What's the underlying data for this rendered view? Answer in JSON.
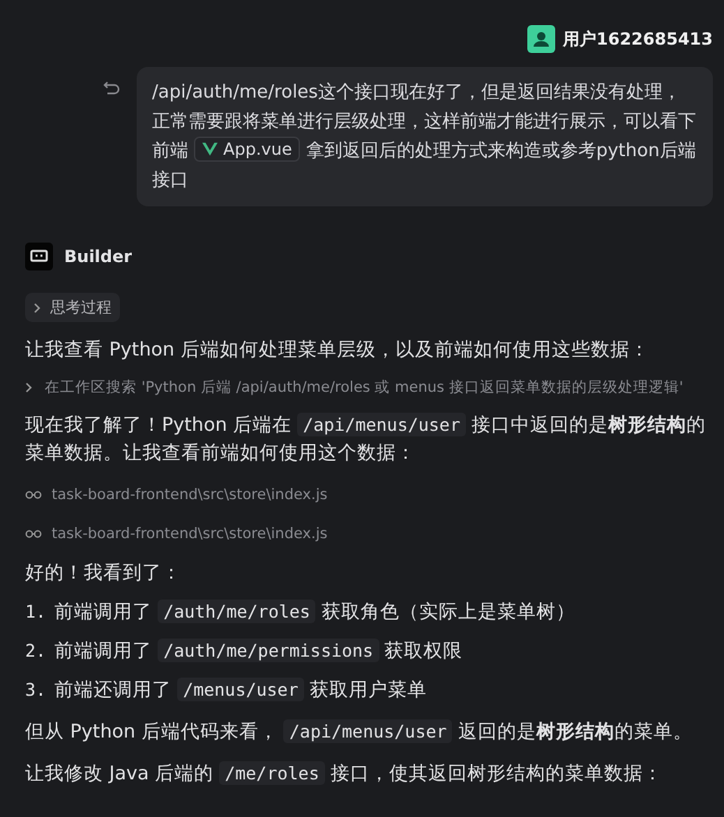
{
  "user": {
    "name": "用户1622685413"
  },
  "user_message": {
    "segments": [
      {
        "kind": "text",
        "text": "/api/auth/me/roles这个接口现在好了，但是返回结果没有处理，正常需要跟将菜单进行层级处理，这样前端才能进行展示，可以看下前端"
      },
      {
        "kind": "file",
        "text": "App.vue"
      },
      {
        "kind": "text",
        "text": "拿到返回后的处理方式来构造或参考python后端接口"
      }
    ]
  },
  "assistant": {
    "name": "Builder",
    "thinking": {
      "label": "思考过程",
      "expanded": false
    },
    "blocks": [
      {
        "kind": "para",
        "segments": [
          {
            "kind": "text",
            "text": "让我查看 Python 后端如何处理菜单层级，以及前端如何使用这些数据："
          }
        ]
      },
      {
        "kind": "search",
        "text": "在工作区搜索 'Python 后端 /api/auth/me/roles 或 menus 接口返回菜单数据的层级处理逻辑'"
      },
      {
        "kind": "para",
        "segments": [
          {
            "kind": "text",
            "text": "现在我了解了！Python 后端在"
          },
          {
            "kind": "code",
            "text": "/api/menus/user"
          },
          {
            "kind": "text",
            "text": "接口中返回的是**树形结构**的菜单数据。让我查看前端如何使用这个数据："
          }
        ]
      },
      {
        "kind": "file",
        "text": "task-board-frontend\\src\\store\\index.js"
      },
      {
        "kind": "file",
        "text": "task-board-frontend\\src\\store\\index.js"
      },
      {
        "kind": "para",
        "segments": [
          {
            "kind": "text",
            "text": "好的！我看到了："
          }
        ]
      },
      {
        "kind": "item",
        "number": "1.",
        "segments": [
          {
            "kind": "text",
            "text": "前端调用了"
          },
          {
            "kind": "code",
            "text": "/auth/me/roles"
          },
          {
            "kind": "text",
            "text": "获取角色（实际上是菜单树）"
          }
        ]
      },
      {
        "kind": "item",
        "number": "2.",
        "segments": [
          {
            "kind": "text",
            "text": "前端调用了"
          },
          {
            "kind": "code",
            "text": "/auth/me/permissions"
          },
          {
            "kind": "text",
            "text": "获取权限"
          }
        ]
      },
      {
        "kind": "item",
        "number": "3.",
        "segments": [
          {
            "kind": "text",
            "text": "前端还调用了"
          },
          {
            "kind": "code",
            "text": "/menus/user"
          },
          {
            "kind": "text",
            "text": "获取用户菜单"
          }
        ]
      },
      {
        "kind": "para",
        "segments": [
          {
            "kind": "text",
            "text": "但从 Python 后端代码来看，"
          },
          {
            "kind": "code",
            "text": "/api/menus/user"
          },
          {
            "kind": "text",
            "text": "返回的是**树形结构**的菜单。"
          }
        ]
      },
      {
        "kind": "para",
        "segments": [
          {
            "kind": "text",
            "text": "让我修改 Java 后端的"
          },
          {
            "kind": "code",
            "text": "/me/roles"
          },
          {
            "kind": "text",
            "text": "接口，使其返回树形结构的菜单数据："
          }
        ]
      }
    ]
  }
}
